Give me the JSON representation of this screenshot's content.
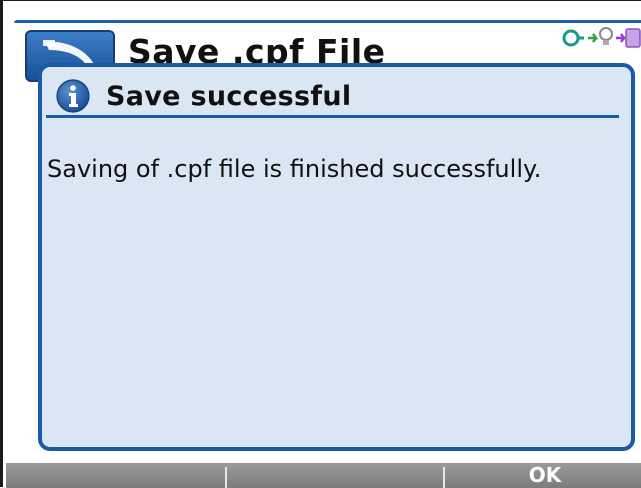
{
  "header": {
    "title": "Save .cpf File",
    "app_icon": "back-arrow-icon",
    "status_icons": [
      "link-icon",
      "bulb-icon",
      "arrows-icon"
    ],
    "accent_color": "#1f5fa8"
  },
  "dialog": {
    "icon": "info-icon",
    "title": "Save successful",
    "message": "Saving of .cpf file is finished successfully.",
    "background_color": "#dbe6f5",
    "border_color": "#1b5ba6"
  },
  "softkeys": {
    "key1_label": "",
    "key2_label": "",
    "key3_label": "OK"
  }
}
